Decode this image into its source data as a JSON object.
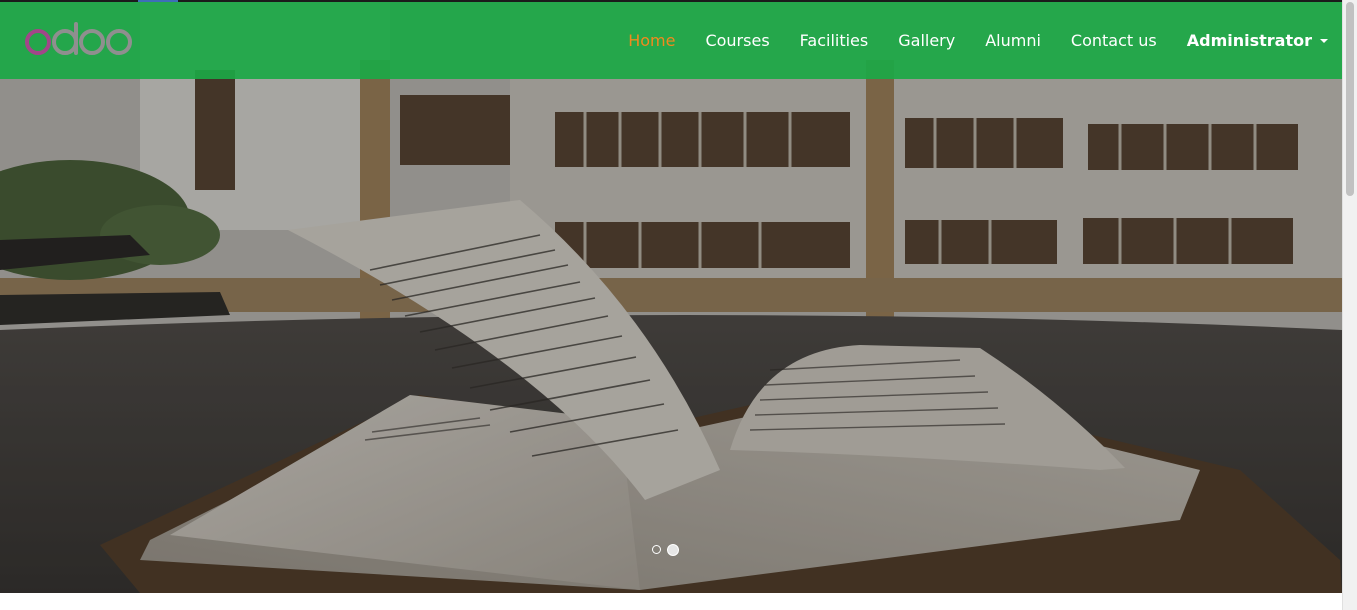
{
  "brand": {
    "logo_text": "odoo",
    "colors": {
      "navbar": "#1ca846",
      "active_link": "#f08a1e",
      "logo_o": "#a24689",
      "logo_letters": "#8f8f8f"
    }
  },
  "nav": {
    "items": [
      {
        "label": "Home",
        "active": true
      },
      {
        "label": "Courses",
        "active": false
      },
      {
        "label": "Facilities",
        "active": false
      },
      {
        "label": "Gallery",
        "active": false
      },
      {
        "label": "Alumni",
        "active": false
      },
      {
        "label": "Contact us",
        "active": false
      }
    ],
    "user_label": "Administrator"
  },
  "carousel": {
    "slide_count": 2,
    "active_index": 1
  }
}
